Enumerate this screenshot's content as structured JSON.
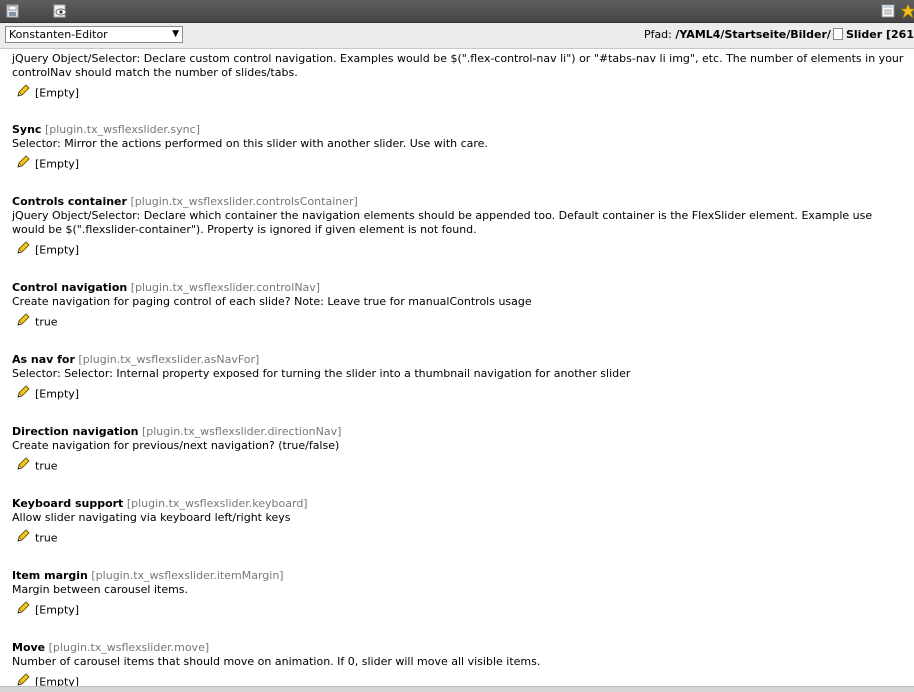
{
  "toolbar": {
    "icons": [
      "save-icon",
      "view-icon",
      "calendar-icon",
      "bookmark-star-icon"
    ]
  },
  "module": {
    "select_value": "Konstanten-Editor"
  },
  "path": {
    "label": "Pfad:",
    "value": "/YAML4/Startseite/Bilder/",
    "page": "Slider [261"
  },
  "partial": {
    "desc": "jQuery Object/Selector: Declare custom control navigation. Examples would be $(\".flex-control-nav li\") or \"#tabs-nav li img\", etc. The number of elements in your controlNav should match the number of slides/tabs.",
    "value": "[Empty]"
  },
  "entries": [
    {
      "title": "Sync",
      "key": "[plugin.tx_wsflexslider.sync]",
      "desc": "Selector: Mirror the actions performed on this slider with another slider. Use with care.",
      "value": "[Empty]"
    },
    {
      "title": "Controls container",
      "key": "[plugin.tx_wsflexslider.controlsContainer]",
      "desc": "jQuery Object/Selector: Declare which container the navigation elements should be appended too. Default container is the FlexSlider element. Example use would be $(\".flexslider-container\"). Property is ignored if given element is not found.",
      "value": "[Empty]"
    },
    {
      "title": "Control navigation",
      "key": "[plugin.tx_wsflexslider.controlNav]",
      "desc": "Create navigation for paging control of each slide? Note: Leave true for manualControls usage",
      "value": "true"
    },
    {
      "title": "As nav for",
      "key": "[plugin.tx_wsflexslider.asNavFor]",
      "desc": "Selector: Selector: Internal property exposed for turning the slider into a thumbnail navigation for another slider",
      "value": "[Empty]"
    },
    {
      "title": "Direction navigation",
      "key": "[plugin.tx_wsflexslider.directionNav]",
      "desc": "Create navigation for previous/next navigation? (true/false)",
      "value": "true"
    },
    {
      "title": "Keyboard support",
      "key": "[plugin.tx_wsflexslider.keyboard]",
      "desc": "Allow slider navigating via keyboard left/right keys",
      "value": "true"
    },
    {
      "title": "Item margin",
      "key": "[plugin.tx_wsflexslider.itemMargin]",
      "desc": "Margin between carousel items.",
      "value": "[Empty]"
    },
    {
      "title": "Move",
      "key": "[plugin.tx_wsflexslider.move]",
      "desc": "Number of carousel items that should move on animation. If 0, slider will move all visible items.",
      "value": "[Empty]"
    }
  ]
}
